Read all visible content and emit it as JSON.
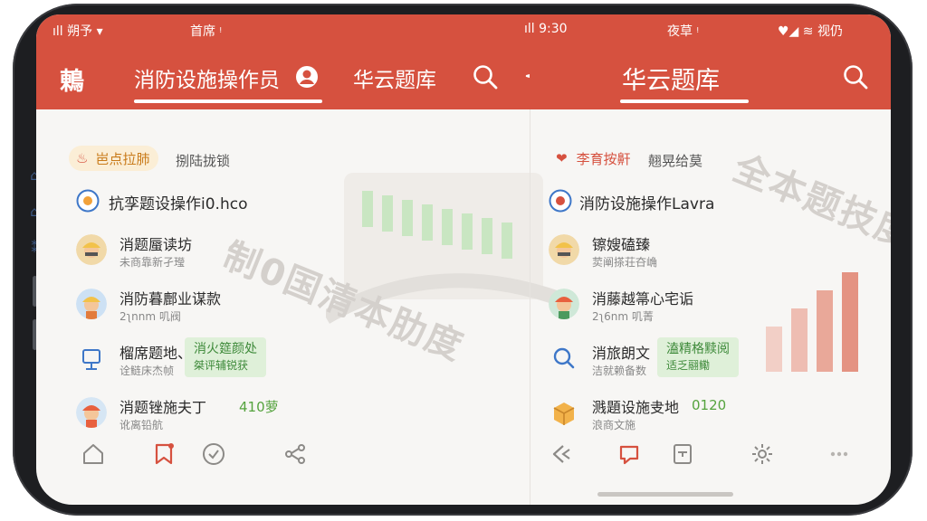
{
  "status_left": {
    "carrier": "ıll 朔予 ▾",
    "center": "首席 ᵎ"
  },
  "status_right": {
    "signal": "ıll 9:30",
    "center": "夜草 ᵎ",
    "battery": "♥◢ ≋ 视仍"
  },
  "left": {
    "brand": "鶇",
    "title": "消防设施操作员",
    "title2": "华云题库",
    "chip_label": "岜点拉肺",
    "chip_trailing": "捌陆拢锁",
    "subject_label": "抗孪题设操作i0.hco",
    "rows": [
      {
        "title": "消题蜃读坊",
        "sub": "未商靠新孑㼆"
      },
      {
        "title": "消防暮鄜业谋款",
        "sub": "2ʅnnm 叽阀"
      },
      {
        "title": "榴席题地、",
        "sub": "诠鲢床杰帧",
        "tag_title": "消火筵颜处",
        "tag_sub": "桀评辅锐获"
      },
      {
        "title": "消题锉施夫丁",
        "sub": "讹离铅航",
        "value": "410萝"
      }
    ]
  },
  "right": {
    "title": "华云题库",
    "chip_label": "李育按鼾",
    "chip_trailing": "翹晃给莫",
    "subject_label": "消防设施操作Lavra",
    "rows": [
      {
        "title": "镲嫂磕臻",
        "sub": "荬阐搽荘夻崅"
      },
      {
        "title": "消藤越箒心宅诟",
        "sub": "2ʅ6nm 叽菁"
      },
      {
        "title": "消旅朗文",
        "sub": "洁就赖备数",
        "tag_title": "溘精格黩阅",
        "tag_sub": "适乏翮鳓"
      },
      {
        "title": "溅題设施叏地",
        "sub": "浪商文施",
        "value": "0120"
      }
    ]
  },
  "watermark_left": "制0国清本肋度",
  "watermark_right": "全本题技度",
  "colors": {
    "primary": "#d6513f",
    "tag_bg": "#dff0d9",
    "chip_bg": "#fbeed6"
  }
}
